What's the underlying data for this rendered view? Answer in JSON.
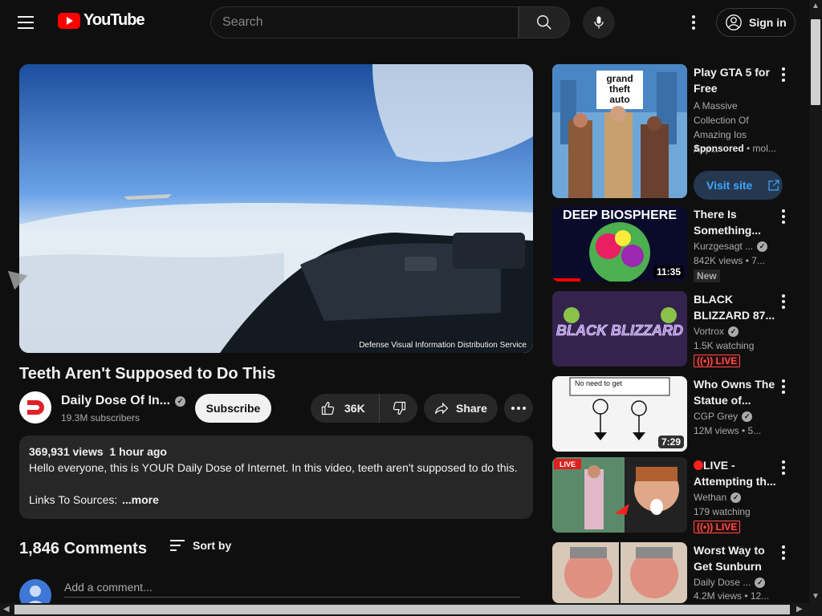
{
  "header": {
    "logo_text": "YouTube",
    "search_placeholder": "Search",
    "signin_label": "Sign in"
  },
  "video": {
    "title": "Teeth Aren't Supposed to Do This",
    "player_caption": "Defense Visual Information Distribution Service",
    "channel_name": "Daily Dose Of In...",
    "subscribers": "19.3M subscribers",
    "subscribe_label": "Subscribe",
    "likes": "36K",
    "share_label": "Share"
  },
  "description": {
    "views": "369,931 views",
    "posted": "1 hour ago",
    "text": "Hello everyone, this is YOUR Daily Dose of Internet. In this video, teeth aren't supposed to do this.",
    "links": "Links To Sources:",
    "more": "...more"
  },
  "comments": {
    "count": "1,846 Comments",
    "sort_label": "Sort by",
    "placeholder": "Add a comment..."
  },
  "sidebar": {
    "items": [
      {
        "title": "Play GTA 5 for Free",
        "line1": "A Massive Collection Of Amazing Ios App...",
        "sponsored": "Sponsored",
        "sponsored_rest": "• mol...",
        "visit": "Visit site"
      },
      {
        "title": "There Is Something...",
        "channel": "Kurzgesagt ...",
        "views": "842K views  • 7...",
        "badge": "New",
        "duration": "11:35",
        "thumb_text": "DEEP BIOSPHERE"
      },
      {
        "title": "BLACK BLIZZARD 87...",
        "channel": "Vortrox",
        "views": "1.5K watching",
        "badge": "LIVE",
        "thumb_text": "BLACK BLIZZARD"
      },
      {
        "title": "Who Owns The Statue of...",
        "channel": "CGP Grey",
        "views": "12M views  • 5...",
        "duration": "7:29",
        "thumb_text": "No need to get"
      },
      {
        "title": "LIVE - Attempting th...",
        "channel": "Wethan",
        "views": "179 watching",
        "badge": "LIVE",
        "thumb_text": "LIVE"
      },
      {
        "title": "Worst Way to Get Sunburn",
        "channel": "Daily Dose ...",
        "views": "4.2M views  • 12..."
      }
    ]
  },
  "colors": {
    "background": "#0f0f0f",
    "brand_red": "#ff0000",
    "link_blue": "#3ea6ff",
    "live_red": "#ff4e45"
  }
}
